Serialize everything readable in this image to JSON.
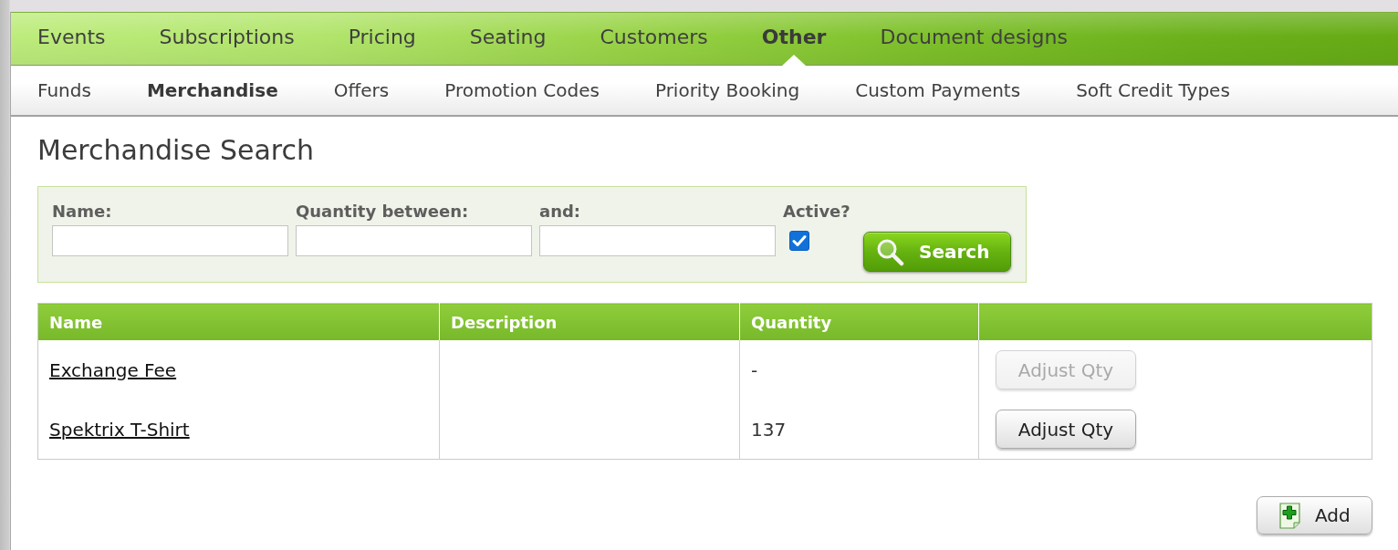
{
  "main_nav": [
    {
      "label": "Events",
      "selected": false
    },
    {
      "label": "Subscriptions",
      "selected": false
    },
    {
      "label": "Pricing",
      "selected": false
    },
    {
      "label": "Seating",
      "selected": false
    },
    {
      "label": "Customers",
      "selected": false
    },
    {
      "label": "Other",
      "selected": true
    },
    {
      "label": "Document designs",
      "selected": false
    }
  ],
  "sub_nav": [
    {
      "label": "Funds",
      "selected": false
    },
    {
      "label": "Merchandise",
      "selected": true
    },
    {
      "label": "Offers",
      "selected": false
    },
    {
      "label": "Promotion Codes",
      "selected": false
    },
    {
      "label": "Priority Booking",
      "selected": false
    },
    {
      "label": "Custom Payments",
      "selected": false
    },
    {
      "label": "Soft Credit Types",
      "selected": false
    }
  ],
  "page_title": "Merchandise Search",
  "search_form": {
    "fields": [
      {
        "label": "Name:",
        "kind": "text"
      },
      {
        "label": "Quantity between:",
        "kind": "text"
      },
      {
        "label": "and:",
        "kind": "text"
      },
      {
        "label": "Active?",
        "kind": "checkbox",
        "checked": true
      }
    ],
    "button": "Search"
  },
  "table": {
    "columns": [
      "Name",
      "Description",
      "Quantity"
    ],
    "rows": [
      {
        "name": "Exchange Fee",
        "quantity": "-",
        "action": {
          "label": "Adjust Qty",
          "disabled": true
        }
      },
      {
        "name": "Spektrix T-Shirt",
        "quantity": "137",
        "action": {
          "label": "Adjust Qty",
          "disabled": false
        }
      }
    ]
  },
  "add_button": "Add"
}
